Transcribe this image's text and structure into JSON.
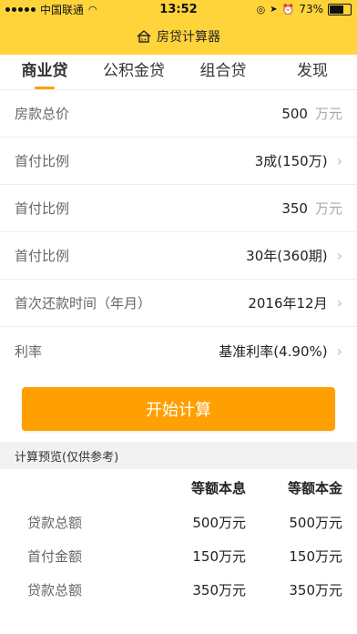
{
  "status_bar": {
    "carrier": "中国联通",
    "time": "13:52",
    "battery": "73%",
    "battery_level": 0.73
  },
  "app": {
    "title": "房贷计算器"
  },
  "tabs": [
    {
      "label": "商业贷",
      "active": true
    },
    {
      "label": "公积金贷",
      "active": false
    },
    {
      "label": "组合贷",
      "active": false
    },
    {
      "label": "发现",
      "active": false
    }
  ],
  "form": {
    "rows": [
      {
        "label": "房款总价",
        "value": "500",
        "unit": "万元",
        "chevron": false
      },
      {
        "label": "首付比例",
        "value": "3成(150万)",
        "unit": "",
        "chevron": true
      },
      {
        "label": "首付比例",
        "value": "350",
        "unit": "万元",
        "chevron": false
      },
      {
        "label": "首付比例",
        "value": "30年(360期)",
        "unit": "",
        "chevron": true
      },
      {
        "label": "首次还款时间（年月）",
        "value": "2016年12月",
        "unit": "",
        "chevron": true
      },
      {
        "label": "利率",
        "value": "基准利率(4.90%)",
        "unit": "",
        "chevron": true
      }
    ]
  },
  "calculate_button": "开始计算",
  "preview": {
    "title": "计算预览(仅供参考)",
    "columns": [
      "",
      "等额本息",
      "等额本金"
    ],
    "rows": [
      [
        "贷款总额",
        "500万元",
        "500万元"
      ],
      [
        "首付金额",
        "150万元",
        "150万元"
      ],
      [
        "贷款总额",
        "350万元",
        "350万元"
      ]
    ]
  },
  "colors": {
    "accent": "#FF9F00",
    "header": "#FFD43B"
  }
}
